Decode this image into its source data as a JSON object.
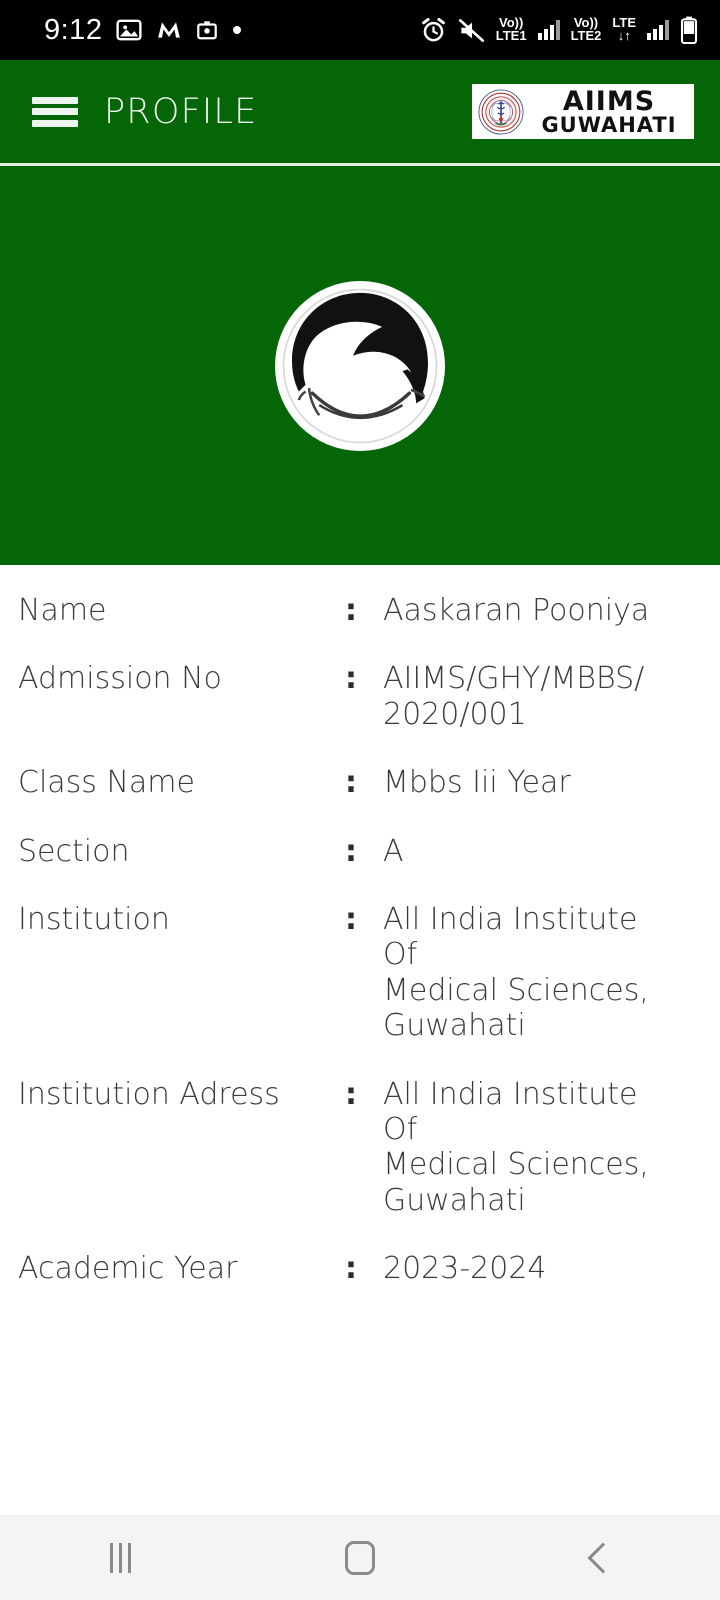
{
  "status_bar": {
    "time": "9:12",
    "left_icons": [
      "gallery-icon",
      "m-app-icon",
      "camera-app-icon",
      "dot-icon"
    ],
    "right_icons": [
      "alarm-icon",
      "mute-icon",
      "volte-sim1-icon",
      "signal-sim1-icon",
      "volte-lte-sim2-icon",
      "signal-sim2-icon",
      "battery-icon"
    ],
    "sim1_volte": "Vo))",
    "sim1_label": "LTE1",
    "sim2_volte": "Vo))",
    "sim2_label": "LTE2",
    "sim2_network": "LTE",
    "sim2_data_arrows": "↓↑"
  },
  "app_bar": {
    "menu_icon": "hamburger-menu-icon",
    "title": "PROFILE",
    "logo": {
      "emblem": "aiims-emblem-icon",
      "line1": "AIIMS",
      "line2": "GUWAHATI"
    },
    "background_color": "#056608"
  },
  "avatar": {
    "icon": "user-avatar-icon",
    "panel_color": "#056608"
  },
  "profile": {
    "rows": [
      {
        "label": "Name",
        "colon": ":",
        "value": "Aaskaran Pooniya"
      },
      {
        "label": "Admission No",
        "colon": ":",
        "value": "AIIMS/GHY/MBBS/\n2020/001"
      },
      {
        "label": "Class Name",
        "colon": ":",
        "value": "Mbbs Iii Year"
      },
      {
        "label": "Section",
        "colon": ":",
        "value": "A"
      },
      {
        "label": "Institution",
        "colon": ":",
        "value": "All India Institute Of\nMedical Sciences,\nGuwahati"
      },
      {
        "label": "Institution Adress",
        "colon": ":",
        "value": "All India Institute Of\nMedical Sciences,\nGuwahati"
      },
      {
        "label": "Academic Year",
        "colon": ":",
        "value": "2023-2024"
      }
    ]
  },
  "nav_bar": {
    "recent_icon": "recents-icon",
    "home_icon": "home-icon",
    "back_icon": "back-icon",
    "background_color": "#f4f4f4"
  }
}
